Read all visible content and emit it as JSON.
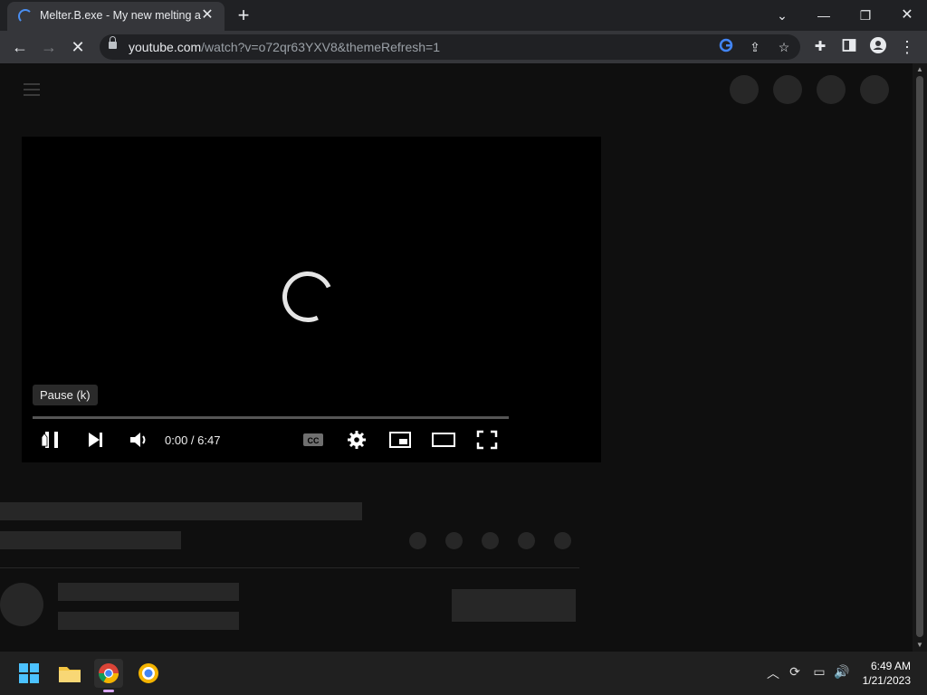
{
  "browser": {
    "tab_title": "Melter.B.exe - My new melting a",
    "url_host": "youtube.com",
    "url_path": "/watch?v=o72qr63YXV8&themeRefresh=1"
  },
  "player": {
    "tooltip": "Pause (k)",
    "time": "0:00 / 6:47",
    "cc_label": "CC"
  },
  "taskbar": {
    "time": "6:49 AM",
    "date": "1/21/2023"
  },
  "icons": {
    "back": "back-arrow-icon",
    "forward": "forward-arrow-icon",
    "stop": "stop-icon",
    "google": "google-icon",
    "share": "share-icon",
    "bookmark": "star-icon",
    "extensions": "puzzle-icon",
    "sidepanel": "side-panel-icon",
    "profile": "profile-icon",
    "menu": "kebab-menu-icon"
  }
}
